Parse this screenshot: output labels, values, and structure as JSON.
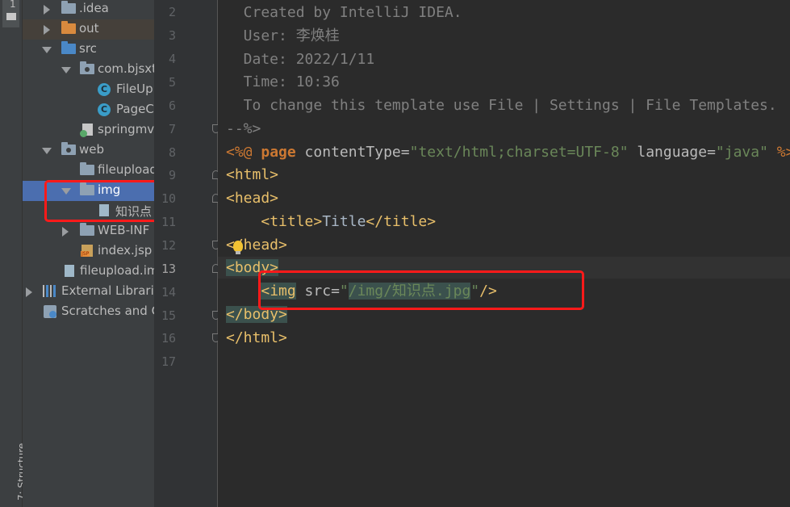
{
  "tool_strip": {
    "top_tab_number": "1",
    "bottom_tab_label": "7: Structure"
  },
  "tree": {
    "rows": [
      {
        "label": ".idea",
        "icon": "folder-icon"
      },
      {
        "label": "out",
        "icon": "folder-orange-icon"
      },
      {
        "label": "src",
        "icon": "folder-blue-icon"
      },
      {
        "label": "com.bjsxt",
        "icon": "package-icon"
      },
      {
        "label": "FileUp",
        "icon": "class-icon"
      },
      {
        "label": "PageC",
        "icon": "class-icon"
      },
      {
        "label": "springmv",
        "icon": "xml-config-icon"
      },
      {
        "label": "web",
        "icon": "web-folder-icon"
      },
      {
        "label": "fileupload",
        "icon": "folder-icon"
      },
      {
        "label": "img",
        "icon": "folder-icon"
      },
      {
        "label": "知识点",
        "icon": "image-file-icon"
      },
      {
        "label": "WEB-INF",
        "icon": "folder-icon"
      },
      {
        "label": "index.jsp",
        "icon": "jsp-file-icon"
      },
      {
        "label": "fileupload.im",
        "icon": "iml-file-icon"
      },
      {
        "label": "External Librarie",
        "icon": "library-icon"
      },
      {
        "label": "Scratches and C",
        "icon": "scratches-icon"
      }
    ],
    "class_icon_letter": "C"
  },
  "gutter": {
    "line_numbers": [
      "2",
      "3",
      "4",
      "5",
      "6",
      "7",
      "8",
      "9",
      "10",
      "11",
      "12",
      "13",
      "14",
      "15",
      "16",
      "17"
    ],
    "current_line": "13"
  },
  "editor": {
    "lines": {
      "l2": "  Created by IntelliJ IDEA.",
      "l3": "  User: 李焕桂",
      "l4": "  Date: 2022/1/11",
      "l5": "  Time: 10:36",
      "l6": "  To change this template use File | Settings | File Templates.",
      "l7": "--%>",
      "l8_open": "<%@ ",
      "l8_kw": "page",
      "l8_a1": " contentType=",
      "l8_s1": "\"text/html;charset=UTF-8\"",
      "l8_a2": " language=",
      "l8_s2": "\"java\"",
      "l8_close": " %>",
      "l9": "<html>",
      "l10": "<head>",
      "l11_t1": "<title>",
      "l11_text": "Title",
      "l11_t2": "</title>",
      "l12": "</head>",
      "l13": "<body>",
      "l14_tag": "<img",
      "l14_attr": " src=",
      "l14_q1": "\"",
      "l14_val": "/img/知识点.jpg",
      "l14_q2": "\"",
      "l14_end": "/>",
      "l15": "</body>",
      "l16": "</html>"
    }
  },
  "colors": {
    "highlight_box": "#ff1a1a",
    "selection": "#4b6eaf",
    "comment": "#808080",
    "tag": "#e8bf6a",
    "string": "#6a8759",
    "keyword": "#cc7832"
  }
}
